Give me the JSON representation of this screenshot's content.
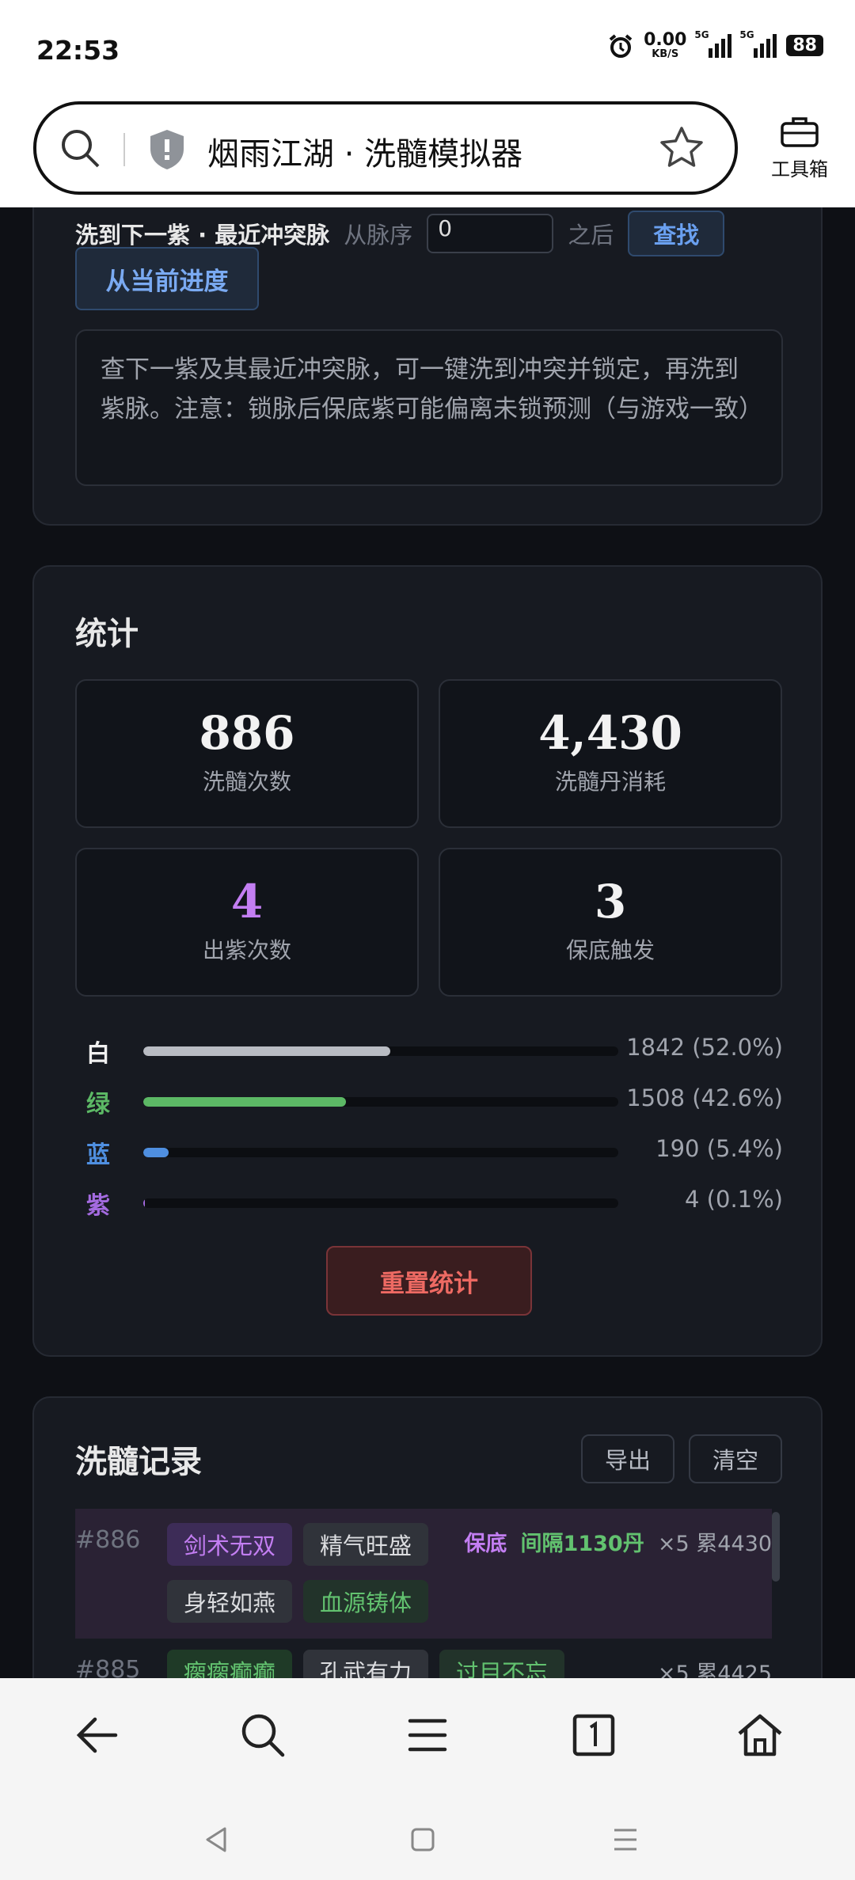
{
  "status_bar": {
    "time": "22:53",
    "net_speed": "0.00",
    "net_unit": "KB/S",
    "sig1": "5G",
    "sig2": "5G",
    "battery": "88"
  },
  "browser": {
    "title": "烟雨江湖 · 洗髓模拟器",
    "toolbox_label": "工具箱"
  },
  "search_card": {
    "label": "洗到下一紫 · 最近冲突脉",
    "from_label": "从脉序",
    "input_value": "0",
    "after_label": "之后",
    "find_button": "查找",
    "progress_button": "从当前进度",
    "note": "查下一紫及其最近冲突脉，可一键洗到冲突并锁定，再洗到紫脉。注意：锁脉后保底紫可能偏离未锁预测（与游戏一致）"
  },
  "stats": {
    "title": "统计",
    "cards": [
      {
        "value": "886",
        "label": "洗髓次数",
        "color": "#f2f2f2"
      },
      {
        "value": "4,430",
        "label": "洗髓丹消耗",
        "color": "#f2f2f2"
      },
      {
        "value": "4",
        "label": "出紫次数",
        "color": "#c37ef2"
      },
      {
        "value": "3",
        "label": "保底触发",
        "color": "#f2f2f2"
      }
    ],
    "bars": [
      {
        "key": "白",
        "value": "1842 (52.0%)",
        "percent": 52.0,
        "color": "#b9bcc3",
        "keycolor": "#f0f0f0"
      },
      {
        "key": "绿",
        "value": "1508 (42.6%)",
        "percent": 42.6,
        "color": "#5cb865",
        "keycolor": "#5cb865"
      },
      {
        "key": "蓝",
        "value": "190 (5.4%)",
        "percent": 5.4,
        "color": "#4f8fe0",
        "keycolor": "#4f8fe0"
      },
      {
        "key": "紫",
        "value": "4 (0.1%)",
        "percent": 0.1,
        "color": "#a46be0",
        "keycolor": "#a46be0"
      }
    ],
    "reset_button": "重置统计"
  },
  "records": {
    "title": "洗髓记录",
    "export_button": "导出",
    "clear_button": "清空",
    "items": [
      {
        "num": "#886",
        "tags": [
          "剑术无双",
          "精气旺盛",
          "身轻如燕",
          "血源铸体"
        ],
        "baodi": "保底",
        "gap": "间隔1130丹",
        "times": "×5",
        "total": "累4430"
      },
      {
        "num": "#885",
        "tags": [
          "瘸瘸癫癫",
          "孔武有力",
          "过目不忘"
        ],
        "times": "×5",
        "total": "累4425"
      }
    ]
  }
}
